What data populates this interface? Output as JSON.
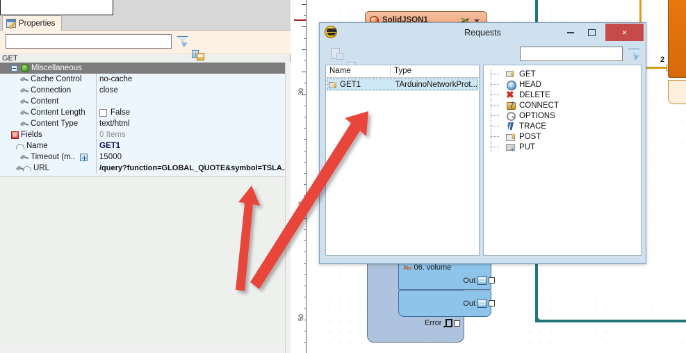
{
  "app": {
    "left_panel": {
      "tab": {
        "label": "Properties",
        "icon": "properties-icon"
      },
      "search_placeholder": "",
      "search_value": "",
      "toolbar_icons": [
        "filter-funnel-icon",
        "group-by-category-icon",
        "group-by-name-icon",
        "show-hidden-icon",
        "pin-icon",
        "tools-icon"
      ],
      "root_label": "GET",
      "category_header": "Miscellaneous",
      "rows": [
        {
          "name": "Cache Control",
          "value": "no-cache",
          "icon": "property-plug-icon",
          "style": "normal"
        },
        {
          "name": "Connection",
          "value": "close",
          "icon": "property-plug-icon",
          "style": "normal"
        },
        {
          "name": "Content",
          "value": "",
          "icon": "property-plug-icon",
          "style": "normal"
        },
        {
          "name": "Content Length",
          "value": "False",
          "icon": "property-plug-icon",
          "style": "checkbox"
        },
        {
          "name": "Content Type",
          "value": "text/html",
          "icon": "property-plug-icon",
          "style": "normal"
        },
        {
          "name": "Fields",
          "value": "0 Items",
          "icon": "collection-icon",
          "style": "grey"
        },
        {
          "name": "Name",
          "value": "GET1",
          "icon": "property-arc-icon",
          "style": "bold-blue"
        },
        {
          "name": "Timeout  (m..",
          "value": "15000",
          "icon": "property-plug-icon",
          "style": "expandable"
        },
        {
          "name": "URL",
          "value": "/query?function=GLOBAL_QUOTE&symbol=TSLA..",
          "icon": "property-link-icon",
          "style": "bold"
        }
      ]
    },
    "ruler": {
      "labels": [
        "30",
        "40",
        "50"
      ]
    },
    "dialog": {
      "title": "Requests",
      "icon": "requests-window-icon",
      "window_buttons": {
        "minimize": "–",
        "maximize": "□",
        "close": "×"
      },
      "toolbar_icons": [
        "add-request-icon",
        "remove-request-icon",
        "globe-icon",
        "delete-icon",
        "move-up-icon",
        "move-down-icon",
        "expand-all-icon",
        "collapse-all-icon"
      ],
      "search_value": "",
      "filter_icon": "filter-funnel-icon",
      "list": {
        "columns": [
          "Name",
          "Type"
        ],
        "rows": [
          {
            "name": "GET1",
            "type": "TArduinoNetworkProt...",
            "selected": true,
            "icon": "get-request-icon"
          }
        ]
      },
      "methods": [
        {
          "label": "GET",
          "icon": "method-get-icon"
        },
        {
          "label": "HEAD",
          "icon": "method-head-icon"
        },
        {
          "label": "DELETE",
          "icon": "method-delete-icon"
        },
        {
          "label": "CONNECT",
          "icon": "method-connect-icon"
        },
        {
          "label": "OPTIONS",
          "icon": "method-options-icon"
        },
        {
          "label": "TRACE",
          "icon": "method-trace-icon"
        },
        {
          "label": "POST",
          "icon": "method-post-icon"
        },
        {
          "label": "PUT",
          "icon": "method-put-icon"
        }
      ]
    },
    "canvas": {
      "nodes": [
        {
          "title": "SolidJSON1",
          "icon": "solidjson-icon",
          "tools_icon": "wrench-icon",
          "caret_icon": "chevron-down-icon"
        },
        {
          "title": "06. volume",
          "icon": "abc-icon",
          "ports": [
            {
              "label": "Out",
              "icon": "monitor-icon"
            },
            {
              "label": "Out",
              "icon": "monitor-icon"
            },
            {
              "label": "Error",
              "icon": "pulse-icon"
            }
          ]
        }
      ],
      "pin_label": "2"
    },
    "colors": {
      "accent_orange": "#e8780f",
      "teal_wire": "#20757a",
      "orange_wire": "#d99b1a",
      "annotation_red": "#e8443a",
      "dialog_chrome": "#cfe0ee",
      "close_button": "#c74a4a",
      "selection": "#cfe8f5",
      "properties_bg": "#fdf1e6",
      "grid_bg": "#eef6fd"
    }
  }
}
